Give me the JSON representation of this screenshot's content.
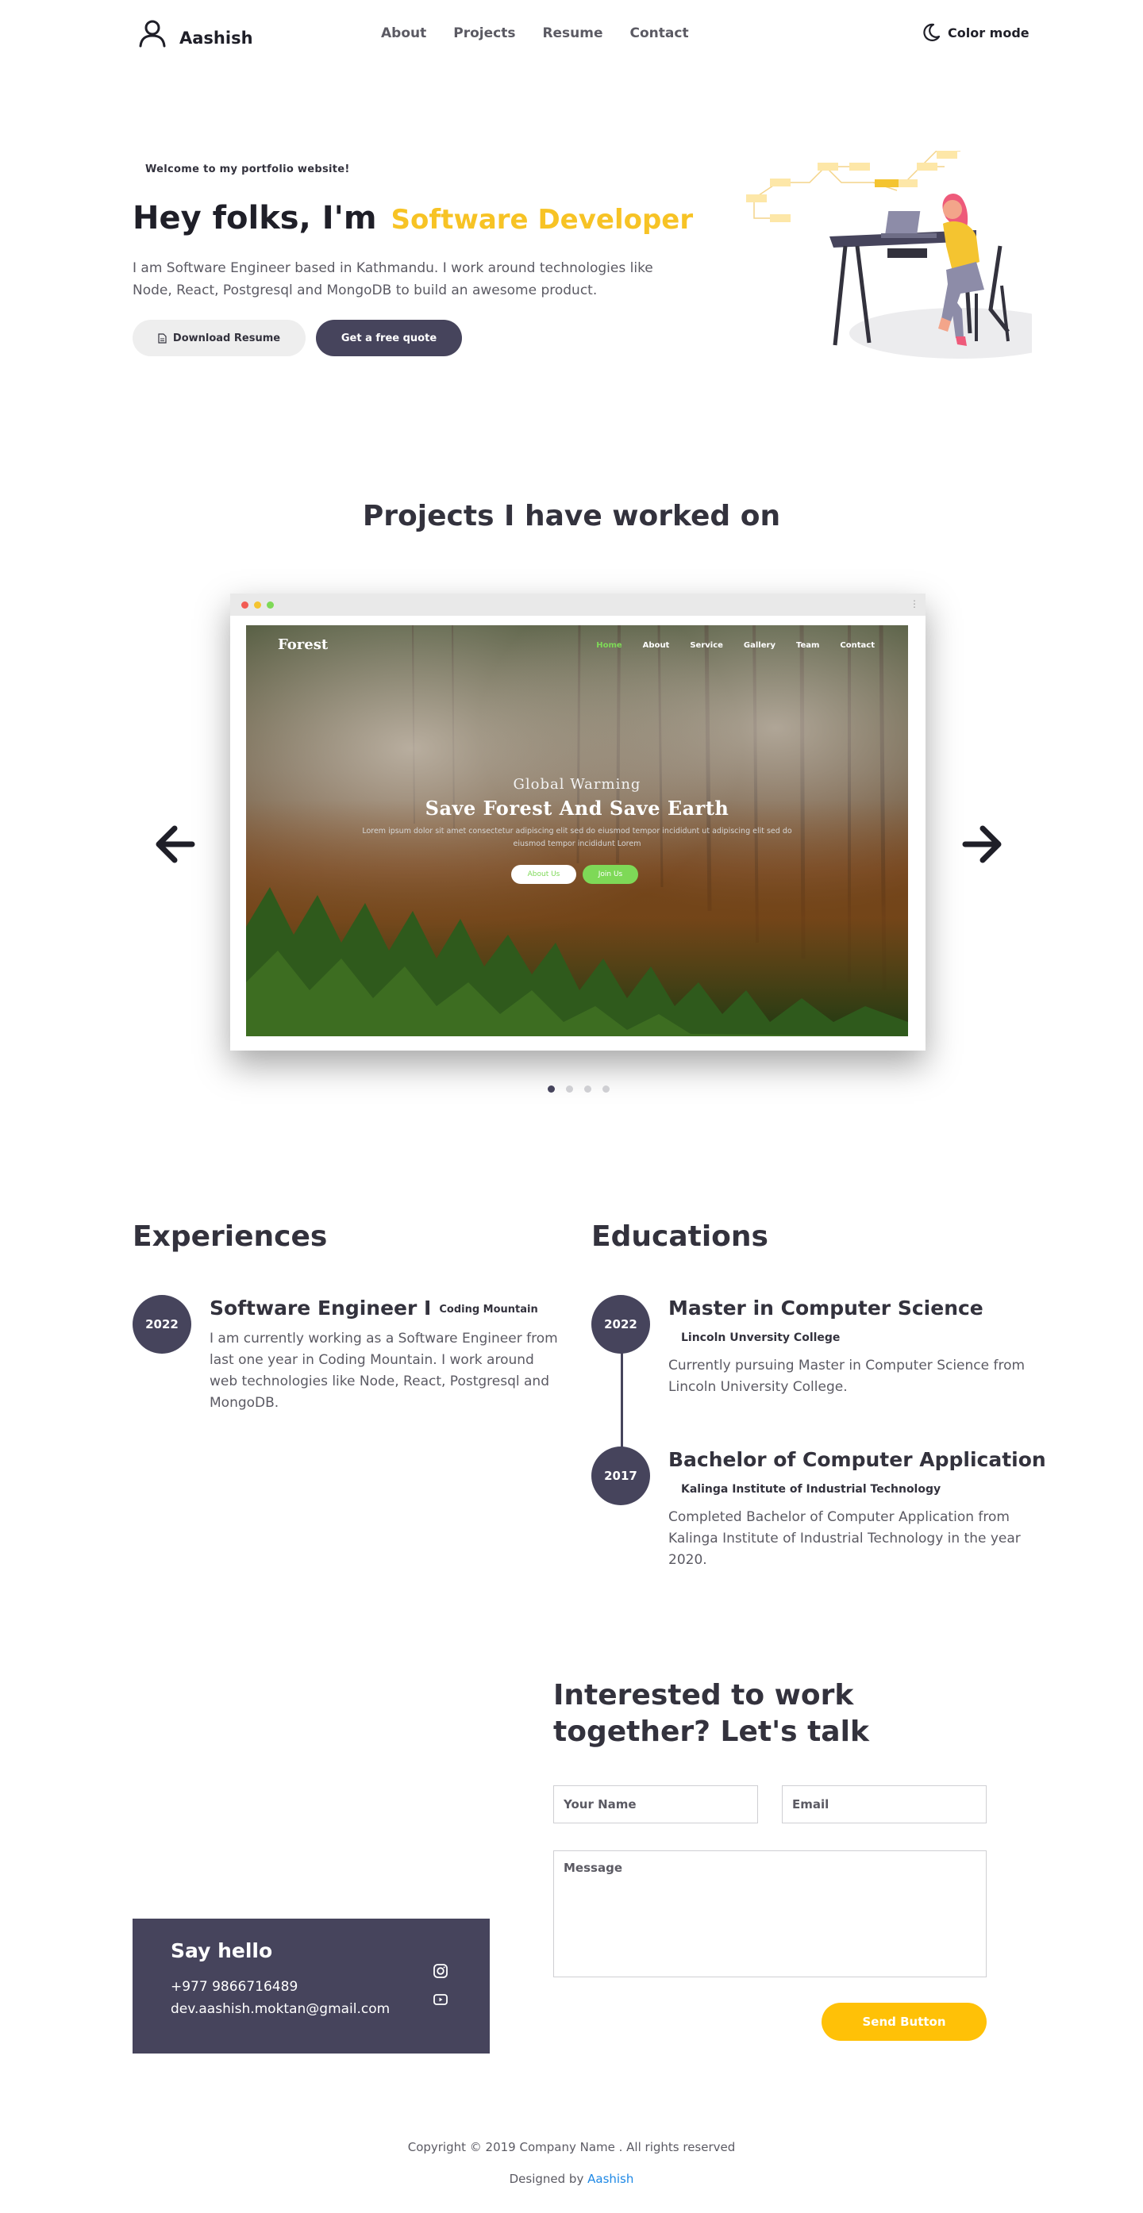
{
  "nav": {
    "brand": "Aashish",
    "links": [
      "About",
      "Projects",
      "Resume",
      "Contact"
    ],
    "color_mode": "Color mode"
  },
  "hero": {
    "welcome": "Welcome to my portfolio website!",
    "greeting": "Hey folks, I'm",
    "role": "Software Developer",
    "description": "I am Software Engineer based in Kathmandu. I work around technologies like Node, React, Postgresql and MongoDB to build an awesome product.",
    "download_label": "Download Resume",
    "quote_label": "Get a free quote"
  },
  "projects": {
    "title": "Projects I have worked on",
    "active_slide": 0,
    "slide_count": 4,
    "slide": {
      "logo": "Forest",
      "nav": [
        "Home",
        "About",
        "Service",
        "Gallery",
        "Team",
        "Contact"
      ],
      "kicker": "Global Warming",
      "headline": "Save Forest And Save Earth",
      "lorem": "Lorem ipsum dolor sit amet consectetur adipiscing elit sed do eiusmod tempor incididunt ut adipiscing elit sed do eiusmod tempor incididunt Lorem",
      "btn_about": "About Us",
      "btn_join": "Join Us"
    }
  },
  "experiences": {
    "title": "Experiences",
    "items": [
      {
        "year": "2022",
        "title": "Software Engineer I",
        "org": "Coding Mountain",
        "description": "I am currently working as a Software Engineer from last one year in Coding Mountain. I work around web technologies like Node, React, Postgresql and MongoDB."
      }
    ]
  },
  "educations": {
    "title": "Educations",
    "items": [
      {
        "year": "2022",
        "title": "Master in Computer Science",
        "org": "Lincoln Unversity College",
        "description": "Currently pursuing Master in Computer Science from Lincoln University College."
      },
      {
        "year": "2017",
        "title": "Bachelor of Computer Application",
        "org": "Kalinga Institute of Industrial Technology",
        "description": "Completed Bachelor of Computer Application from Kalinga Institute of Industrial Technology in the year 2020."
      }
    ]
  },
  "contact": {
    "title": "Interested to work together? Let's talk",
    "name_placeholder": "Your Name",
    "email_placeholder": "Email",
    "message_placeholder": "Message",
    "send_label": "Send Button"
  },
  "say_hello": {
    "title": "Say hello",
    "phone": "+977 9866716489",
    "email": "dev.aashish.moktan@gmail.com",
    "icons": [
      "instagram-icon",
      "youtube-icon"
    ]
  },
  "footer": {
    "copyright": "Copyright © 2019 Company Name . All rights reserved",
    "designed_prefix": "Designed by",
    "designed_name": "Aashish"
  },
  "colors": {
    "accent": "#f7c325",
    "primary": "#46445c",
    "send_button": "#ffc107",
    "link": "#1e88e5",
    "slide_accent": "#7ed957"
  }
}
